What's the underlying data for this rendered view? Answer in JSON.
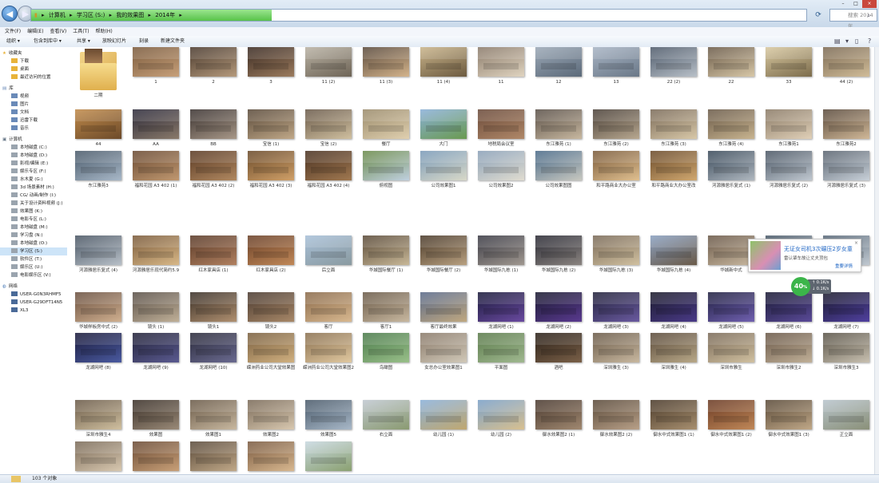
{
  "address": {
    "crumbs": [
      "计算机",
      "学习区 (S:)",
      "我的效果图",
      "2014年"
    ],
    "progress": 0.31,
    "search_placeholder": "搜索 2014年"
  },
  "window_buttons": {
    "min": "–",
    "max": "□",
    "close": "×"
  },
  "menu": [
    "文件(F)",
    "编辑(E)",
    "查看(V)",
    "工具(T)",
    "帮助(H)"
  ],
  "toolbar": {
    "organize": "组织 ▾",
    "include": "包含到库中 ▾",
    "share": "共享 ▾",
    "slideshow": "放映幻灯片",
    "burn": "刻录",
    "new_folder": "新建文件夹"
  },
  "nav": {
    "favorites": {
      "title": "收藏夹",
      "items": [
        "下载",
        "桌面",
        "最近访问的位置"
      ]
    },
    "library": {
      "title": "库",
      "items": [
        "视频",
        "图片",
        "文档",
        "迅雷下载",
        "音乐"
      ]
    },
    "computer": {
      "title": "计算机",
      "items": [
        "本地磁盘 (C:)",
        "本地磁盘 (D:)",
        "影视/编辑 (E:)",
        "娱乐专区 (F:)",
        "水木夏 (G:)",
        "3d 场景素材 (H:)",
        "CG/ 动画/制作 (I:)",
        "关于设计资料视频 (J:)",
        "效果图 (K:)",
        "电影专区 (L:)",
        "本地磁盘 (M:)",
        "学习盘 (N:)",
        "本地磁盘 (O:)",
        "学习区 (S:)",
        "软件区 (T:)",
        "娱乐区 (U:)",
        "电影娱乐区 (V:)"
      ]
    },
    "network": {
      "title": "网络",
      "items": [
        "USER-G0N3RHMF5",
        "USER-G29DFT14N5",
        "XL3"
      ]
    }
  },
  "files": [
    "二期",
    "1",
    "2",
    "3",
    "11 (2)",
    "11 (3)",
    "11 (4)",
    "11",
    "12",
    "13",
    "22 (2)",
    "22",
    "33",
    "44 (2)",
    "44",
    "AA",
    "BB",
    "宝信 (1)",
    "宝信 (2)",
    "餐厅",
    "大门",
    "地税局会议室",
    "东江雅苑 (1)",
    "东江雅苑 (2)",
    "东江雅苑 (3)",
    "东江雅苑 (4)",
    "东江雅苑1",
    "东江雅苑2",
    "东江雅苑3",
    "福和花园 A3 402 (1)",
    "福和花园 A3 402 (2)",
    "福和花园 A3 402 (3)",
    "福和花园 A3 402 (4)",
    "俯视图",
    "公司效果图1",
    "公司效果图2",
    "公司效果图图",
    "和平路商业大办公室",
    "和平路商业大办公室改",
    "河源雅居乐复式 (1)",
    "河源雅居乐复式 (2)",
    "河源雅居乐复式 (3)",
    "河源雅居乐复式 (4)",
    "河源雅居乐现代简约5.9",
    "红木家具店 (1)",
    "红木家具店 (2)",
    "后立面",
    "华城国际餐厅 (1)",
    "华城国际餐厅 (2)",
    "华城国际九栋 (1)",
    "华城国际九栋 (2)",
    "华城国际九栋 (3)",
    "华城国际九栋 (4)",
    "华城新中式",
    "华城新中式 (1)",
    "华城新中式 (2)",
    "华城样板房中式 (2)",
    "镜头 (1)",
    "镜头1",
    "镜头2",
    "客厅",
    "客厅1",
    "客厅最终效果",
    "龙湖网吧 (1)",
    "龙湖网吧 (2)",
    "龙湖网吧 (3)",
    "龙湖网吧 (4)",
    "龙湖网吧 (5)",
    "龙湖网吧 (6)",
    "龙湖网吧 (7)",
    "龙湖网吧 (8)",
    "龙湖网吧 (9)",
    "龙湖网吧 (10)",
    "嵘洲药业公司大堂效果图",
    "嵘洲药业公司大堂效果图2",
    "鸟瞰图",
    "女总办公室效果图1",
    "平面图",
    "酒吧",
    "深圳雅生 (3)",
    "深圳雅生 (4)",
    "深圳市雅生",
    "深圳市雅生2",
    "深圳市雅生3",
    "深圳市雅生4",
    "效果图",
    "效果图1",
    "效果图2",
    "效果图5",
    "右立面",
    "幼儿园 (1)",
    "幼儿园 (2)",
    "御水效果图2 (1)",
    "御水效果图2 (2)",
    "御水中式效果图1 (1)",
    "御水中式效果图1 (2)",
    "御水中式效果图1 (3)",
    "正立面",
    "",
    "",
    "",
    "",
    ""
  ],
  "tile_colors": [
    [
      "#e9c46a",
      "#d8a94a"
    ],
    [
      "#7a5a3c",
      "#c7a07a"
    ],
    [
      "#4a3a2e",
      "#b59a7c"
    ],
    [
      "#3a2a22",
      "#9c7c5e"
    ],
    [
      "#b9b2a4",
      "#6e6456"
    ],
    [
      "#5a4a3c",
      "#d4b48c"
    ],
    [
      "#c9b48a",
      "#6c5a40"
    ],
    [
      "#8a7a6a",
      "#e0d4c0"
    ],
    [
      "#9ba8b6",
      "#5c6a7a"
    ],
    [
      "#a8b4c4",
      "#6a7888"
    ],
    [
      "#4e5a6a",
      "#b8c0c8"
    ],
    [
      "#6a5a48",
      "#d8c8a8"
    ],
    [
      "#d8c8a0",
      "#7c6c4c"
    ],
    [
      "#7c6a54",
      "#d0bc98"
    ],
    [
      "#c08a4a",
      "#6c4a2a"
    ],
    [
      "#2c2a3a",
      "#8a7a6a"
    ],
    [
      "#3a3230",
      "#a89888"
    ],
    [
      "#5a4a3a",
      "#c0a888"
    ],
    [
      "#6a5a4a",
      "#d0c0a0"
    ],
    [
      "#9a8a6a",
      "#e0d0b0"
    ],
    [
      "#8ab0d8",
      "#6a9a50"
    ],
    [
      "#6a4a3a",
      "#b08868"
    ],
    [
      "#5a5048",
      "#c8b8a0"
    ],
    [
      "#4a4038",
      "#b8a890"
    ],
    [
      "#7a6a58",
      "#d8c8a8"
    ],
    [
      "#6a5a48",
      "#c8b490"
    ],
    [
      "#8a7a66",
      "#e0d0b8"
    ],
    [
      "#5a4a3c",
      "#d0b898"
    ],
    [
      "#4a5a6a",
      "#a8b8c8"
    ],
    [
      "#6a4a32",
      "#c09870"
    ],
    [
      "#5a3a24",
      "#b08860"
    ],
    [
      "#6a4a2a",
      "#d0a068"
    ],
    [
      "#4a3222",
      "#a07850"
    ],
    [
      "#6a8a4a",
      "#c0d0e0"
    ],
    [
      "#7a9ab8",
      "#d8d8c8"
    ],
    [
      "#8aa0b8",
      "#e0dcd0"
    ],
    [
      "#4a6a88",
      "#c8c8c0"
    ],
    [
      "#7a5a3a",
      "#e0c090"
    ],
    [
      "#6a4a2a",
      "#d0a870"
    ],
    [
      "#3a4a5a",
      "#b0b8c0"
    ],
    [
      "#4a5664",
      "#c0c8d0"
    ],
    [
      "#5a6470",
      "#c8d0d8"
    ],
    [
      "#4a5664",
      "#b8c0c8"
    ],
    [
      "#7a5a3a",
      "#d8b888"
    ],
    [
      "#5a3a28",
      "#b08060"
    ],
    [
      "#6a4028",
      "#c08858"
    ],
    [
      "#a8c0d8",
      "#8a9aa0"
    ],
    [
      "#5a4a38",
      "#c8b898"
    ],
    [
      "#4a3a2a",
      "#b8a080"
    ],
    [
      "#3a3a44",
      "#a09890"
    ],
    [
      "#2a2a34",
      "#8a8480"
    ],
    [
      "#7a6a58",
      "#d0c0a0"
    ],
    [
      "#8aa0c0",
      "#6a5a48"
    ],
    [
      "#6a5848",
      "#c8b8a0"
    ],
    [
      "#4a5a6a",
      "#b8c0c8"
    ],
    [
      "#5a6a7a",
      "#c0c8d0"
    ],
    [
      "#6a5040",
      "#d0b090"
    ],
    [
      "#5a5048",
      "#c0b098"
    ],
    [
      "#3a3028",
      "#b09070"
    ],
    [
      "#4a3a30",
      "#a88868"
    ],
    [
      "#8a6a4a",
      "#d8b890"
    ],
    [
      "#6a5a48",
      "#c8b8a0"
    ],
    [
      "#5a6a8a",
      "#c0a880"
    ],
    [
      "#1a1a3a",
      "#6a4aa0"
    ],
    [
      "#1a1a30",
      "#5a3a90"
    ],
    [
      "#22223a",
      "#6a5aa0"
    ],
    [
      "#1a1a2a",
      "#4a3a88"
    ],
    [
      "#202040",
      "#7060b0"
    ],
    [
      "#1a1a34",
      "#5a4a98"
    ],
    [
      "#1a1a2c",
      "#5040a0"
    ],
    [
      "#1a1a3a",
      "#4a5aa0"
    ],
    [
      "#222238",
      "#5a5a90"
    ],
    [
      "#2a2a3a",
      "#6a6a90"
    ],
    [
      "#7a6040",
      "#d0b080"
    ],
    [
      "#8a7050",
      "#e0c8a0"
    ],
    [
      "#4a7a4a",
      "#9ac08a"
    ],
    [
      "#8a7a6a",
      "#d0c8b8"
    ],
    [
      "#5a7a4a",
      "#a0b890"
    ],
    [
      "#2a2018",
      "#7a6048"
    ],
    [
      "#6a5a48",
      "#c8b8a0"
    ],
    [
      "#5a4a3a",
      "#b8a888"
    ],
    [
      "#7a6a58",
      "#d0c0a0"
    ],
    [
      "#6a5848",
      "#c0b098"
    ],
    [
      "#5a5448",
      "#c8c0b0"
    ],
    [
      "#6a5a48",
      "#d0c0a0"
    ],
    [
      "#3a3028",
      "#9a8a78"
    ],
    [
      "#6a5a48",
      "#c8b8a0"
    ],
    [
      "#7a6a58",
      "#d8c8b0"
    ],
    [
      "#4a5a6a",
      "#a8b8c8"
    ],
    [
      "#c0c8d0",
      "#8a9a70"
    ],
    [
      "#8ab0d8",
      "#c0a870"
    ],
    [
      "#7aa0c8",
      "#d8c090"
    ],
    [
      "#4a3a30",
      "#a08870"
    ],
    [
      "#5a4a3a",
      "#b8a088"
    ],
    [
      "#4a3a2a",
      "#a89070"
    ],
    [
      "#6a3a24",
      "#c08858"
    ],
    [
      "#5a4a38",
      "#c0a888"
    ],
    [
      "#b8c4cc",
      "#8a9078"
    ],
    [
      "#7a6a58",
      "#d8c8b0"
    ],
    [
      "#6a4a34",
      "#c8a078"
    ],
    [
      "#5a4a3a",
      "#c0a888"
    ],
    [
      "#7a5a40",
      "#d8b890"
    ],
    [
      "#c8d8e0",
      "#8aa070"
    ]
  ]
}
